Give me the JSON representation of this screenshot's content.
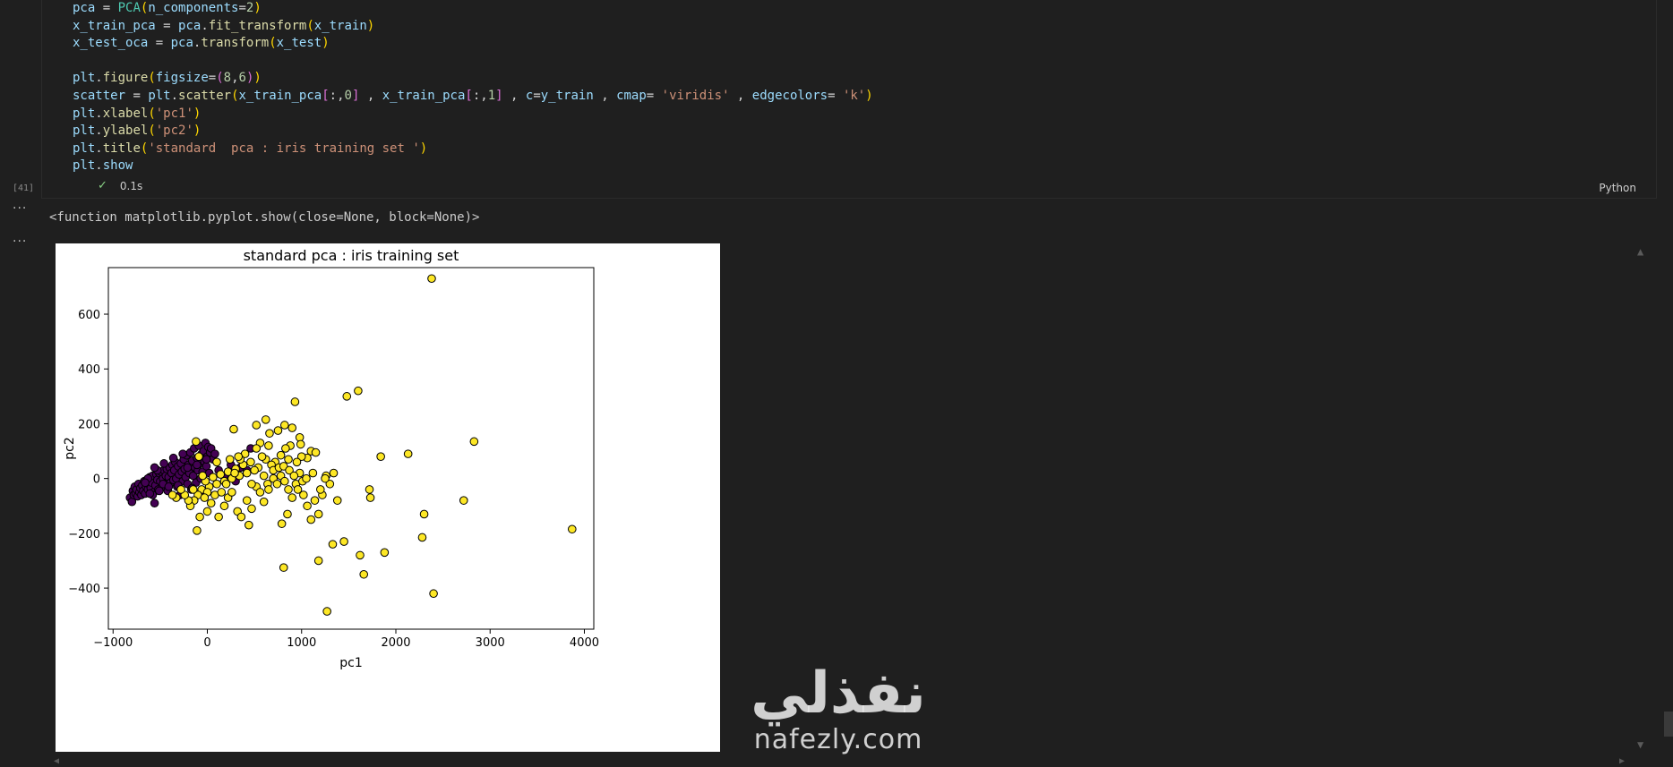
{
  "code_lines": [
    [
      [
        "var",
        "pca"
      ],
      [
        "op",
        " = "
      ],
      [
        "cls",
        "PCA"
      ],
      [
        "par",
        "("
      ],
      [
        "var",
        "n_components"
      ],
      [
        "op",
        "="
      ],
      [
        "num",
        "2"
      ],
      [
        "par",
        ")"
      ]
    ],
    [
      [
        "var",
        "x_train_pca"
      ],
      [
        "op",
        " = "
      ],
      [
        "var",
        "pca"
      ],
      [
        "op",
        "."
      ],
      [
        "fn",
        "fit_transform"
      ],
      [
        "par",
        "("
      ],
      [
        "var",
        "x_train"
      ],
      [
        "par",
        ")"
      ]
    ],
    [
      [
        "var",
        "x_test_oca"
      ],
      [
        "op",
        " = "
      ],
      [
        "var",
        "pca"
      ],
      [
        "op",
        "."
      ],
      [
        "fn",
        "transform"
      ],
      [
        "par",
        "("
      ],
      [
        "var",
        "x_test"
      ],
      [
        "par",
        ")"
      ]
    ],
    [],
    [
      [
        "var",
        "plt"
      ],
      [
        "op",
        "."
      ],
      [
        "fn",
        "figure"
      ],
      [
        "par",
        "("
      ],
      [
        "var",
        "figsize"
      ],
      [
        "op",
        "="
      ],
      [
        "par2",
        "("
      ],
      [
        "num",
        "8"
      ],
      [
        "op",
        ","
      ],
      [
        "num",
        "6"
      ],
      [
        "par2",
        ")"
      ],
      [
        "par",
        ")"
      ]
    ],
    [
      [
        "var",
        "scatter"
      ],
      [
        "op",
        " = "
      ],
      [
        "var",
        "plt"
      ],
      [
        "op",
        "."
      ],
      [
        "fn",
        "scatter"
      ],
      [
        "par",
        "("
      ],
      [
        "var",
        "x_train_pca"
      ],
      [
        "par2",
        "["
      ],
      [
        "op",
        ":,"
      ],
      [
        "num",
        "0"
      ],
      [
        "par2",
        "]"
      ],
      [
        "op",
        " , "
      ],
      [
        "var",
        "x_train_pca"
      ],
      [
        "par2",
        "["
      ],
      [
        "op",
        ":,"
      ],
      [
        "num",
        "1"
      ],
      [
        "par2",
        "]"
      ],
      [
        "op",
        " , "
      ],
      [
        "var",
        "c"
      ],
      [
        "op",
        "="
      ],
      [
        "var",
        "y_train"
      ],
      [
        "op",
        " , "
      ],
      [
        "var",
        "cmap"
      ],
      [
        "op",
        "= "
      ],
      [
        "str",
        "'viridis'"
      ],
      [
        "op",
        " , "
      ],
      [
        "var",
        "edgecolors"
      ],
      [
        "op",
        "= "
      ],
      [
        "str",
        "'k'"
      ],
      [
        "par",
        ")"
      ]
    ],
    [
      [
        "var",
        "plt"
      ],
      [
        "op",
        "."
      ],
      [
        "fn",
        "xlabel"
      ],
      [
        "par",
        "("
      ],
      [
        "str",
        "'pc1'"
      ],
      [
        "par",
        ")"
      ]
    ],
    [
      [
        "var",
        "plt"
      ],
      [
        "op",
        "."
      ],
      [
        "fn",
        "ylabel"
      ],
      [
        "par",
        "("
      ],
      [
        "str",
        "'pc2'"
      ],
      [
        "par",
        ")"
      ]
    ],
    [
      [
        "var",
        "plt"
      ],
      [
        "op",
        "."
      ],
      [
        "fn",
        "title"
      ],
      [
        "par",
        "("
      ],
      [
        "str",
        "'standard  pca : iris training set '"
      ],
      [
        "par",
        ")"
      ]
    ],
    [
      [
        "var",
        "plt"
      ],
      [
        "op",
        "."
      ],
      [
        "var",
        "show"
      ]
    ]
  ],
  "cell": {
    "exec_count": "[41]",
    "time": "0.1s",
    "language": "Python"
  },
  "output_text": "<function matplotlib.pyplot.show(close=None, block=None)>",
  "watermark": {
    "arabic": "نفذلي",
    "latin": "nafezly.com"
  },
  "colors": {
    "class0": "#440154",
    "class1": "#fde725",
    "edge": "#000000"
  },
  "chart_data": {
    "type": "scatter",
    "title": "standard  pca : iris training set",
    "xlabel": "pc1",
    "ylabel": "pc2",
    "xlim": [
      -1050,
      4100
    ],
    "ylim": [
      -550,
      770
    ],
    "xticks": [
      -1000,
      0,
      1000,
      2000,
      3000,
      4000
    ],
    "xtick_labels": [
      "−1000",
      "0",
      "1000",
      "2000",
      "3000",
      "4000"
    ],
    "yticks": [
      -400,
      -200,
      0,
      200,
      400,
      600
    ],
    "ytick_labels": [
      "−400",
      "−200",
      "0",
      "200",
      "400",
      "600"
    ],
    "series": [
      {
        "color": "#440154",
        "points": [
          [
            -820,
            -70
          ],
          [
            -800,
            -85
          ],
          [
            -790,
            -45
          ],
          [
            -780,
            -60
          ],
          [
            -770,
            -30
          ],
          [
            -760,
            -55
          ],
          [
            -750,
            -40
          ],
          [
            -740,
            -65
          ],
          [
            -730,
            -20
          ],
          [
            -720,
            -50
          ],
          [
            -710,
            -35
          ],
          [
            -700,
            -60
          ],
          [
            -690,
            -25
          ],
          [
            -680,
            -45
          ],
          [
            -670,
            -10
          ],
          [
            -660,
            -55
          ],
          [
            -650,
            -30
          ],
          [
            -640,
            -5
          ],
          [
            -630,
            -40
          ],
          [
            -620,
            -20
          ],
          [
            -610,
            5
          ],
          [
            -600,
            -35
          ],
          [
            -590,
            -15
          ],
          [
            -580,
            10
          ],
          [
            -570,
            -50
          ],
          [
            -560,
            -90
          ],
          [
            -550,
            -25
          ],
          [
            -540,
            15
          ],
          [
            -530,
            -5
          ],
          [
            -520,
            -40
          ],
          [
            -510,
            20
          ],
          [
            -500,
            -10
          ],
          [
            -490,
            25
          ],
          [
            -480,
            -30
          ],
          [
            -470,
            0
          ],
          [
            -460,
            30
          ],
          [
            -450,
            -20
          ],
          [
            -440,
            10
          ],
          [
            -430,
            35
          ],
          [
            -420,
            -45
          ],
          [
            -410,
            5
          ],
          [
            -400,
            40
          ],
          [
            -390,
            -15
          ],
          [
            -380,
            20
          ],
          [
            -370,
            50
          ],
          [
            -360,
            -5
          ],
          [
            -350,
            30
          ],
          [
            -340,
            60
          ],
          [
            -330,
            0
          ],
          [
            -320,
            -30
          ],
          [
            -310,
            45
          ],
          [
            -300,
            15
          ],
          [
            -290,
            -60
          ],
          [
            -280,
            55
          ],
          [
            -270,
            25
          ],
          [
            -260,
            -10
          ],
          [
            -250,
            70
          ],
          [
            -240,
            35
          ],
          [
            -230,
            5
          ],
          [
            -220,
            85
          ],
          [
            -210,
            -20
          ],
          [
            -200,
            50
          ],
          [
            -190,
            20
          ],
          [
            -180,
            95
          ],
          [
            -170,
            -40
          ],
          [
            -160,
            65
          ],
          [
            -150,
            10
          ],
          [
            -140,
            110
          ],
          [
            -130,
            40
          ],
          [
            -120,
            -15
          ],
          [
            -110,
            75
          ],
          [
            -100,
            30
          ],
          [
            -90,
            120
          ],
          [
            -80,
            55
          ],
          [
            -70,
            0
          ],
          [
            -60,
            90
          ],
          [
            -50,
            25
          ],
          [
            -40,
            100
          ],
          [
            -30,
            60
          ],
          [
            -20,
            130
          ],
          [
            -10,
            45
          ],
          [
            0,
            80
          ],
          [
            10,
            115
          ],
          [
            20,
            20
          ],
          [
            30,
            95
          ],
          [
            40,
            110
          ],
          [
            60,
            70
          ],
          [
            80,
            90
          ],
          [
            120,
            30
          ],
          [
            180,
            10
          ],
          [
            250,
            50
          ],
          [
            300,
            -10
          ],
          [
            350,
            40
          ],
          [
            420,
            30
          ],
          [
            460,
            110
          ],
          [
            -470,
            -20
          ],
          [
            -530,
            30
          ],
          [
            -580,
            -60
          ],
          [
            -630,
            0
          ],
          [
            -660,
            -15
          ],
          [
            -610,
            -55
          ],
          [
            -560,
            40
          ],
          [
            -510,
            -45
          ],
          [
            -460,
            55
          ],
          [
            -410,
            -30
          ],
          [
            -360,
            75
          ],
          [
            -310,
            -25
          ],
          [
            -260,
            90
          ],
          [
            -210,
            40
          ],
          [
            -160,
            -35
          ],
          [
            -110,
            50
          ],
          [
            -60,
            -45
          ],
          [
            -10,
            70
          ]
        ]
      },
      {
        "color": "#fde725",
        "points": [
          [
            2380,
            730
          ],
          [
            1600,
            320
          ],
          [
            1480,
            300
          ],
          [
            930,
            280
          ],
          [
            280,
            180
          ],
          [
            520,
            195
          ],
          [
            620,
            215
          ],
          [
            820,
            195
          ],
          [
            900,
            185
          ],
          [
            660,
            165
          ],
          [
            750,
            175
          ],
          [
            980,
            150
          ],
          [
            990,
            125
          ],
          [
            880,
            120
          ],
          [
            830,
            110
          ],
          [
            1100,
            100
          ],
          [
            1060,
            75
          ],
          [
            1150,
            95
          ],
          [
            1000,
            80
          ],
          [
            950,
            60
          ],
          [
            860,
            70
          ],
          [
            780,
            85
          ],
          [
            720,
            60
          ],
          [
            680,
            50
          ],
          [
            620,
            70
          ],
          [
            580,
            80
          ],
          [
            540,
            40
          ],
          [
            500,
            30
          ],
          [
            460,
            60
          ],
          [
            420,
            20
          ],
          [
            380,
            50
          ],
          [
            340,
            10
          ],
          [
            300,
            35
          ],
          [
            260,
            0
          ],
          [
            220,
            25
          ],
          [
            180,
            -10
          ],
          [
            140,
            15
          ],
          [
            100,
            -20
          ],
          [
            60,
            5
          ],
          [
            20,
            -30
          ],
          [
            -20,
            -10
          ],
          [
            -60,
            -40
          ],
          [
            -100,
            -60
          ],
          [
            -140,
            -80
          ],
          [
            -180,
            -100
          ],
          [
            -110,
            -190
          ],
          [
            -80,
            -140
          ],
          [
            0,
            -120
          ],
          [
            40,
            -90
          ],
          [
            80,
            -60
          ],
          [
            120,
            -140
          ],
          [
            180,
            -100
          ],
          [
            220,
            -70
          ],
          [
            260,
            -50
          ],
          [
            320,
            -120
          ],
          [
            360,
            -140
          ],
          [
            420,
            -80
          ],
          [
            440,
            -170
          ],
          [
            470,
            -110
          ],
          [
            520,
            -30
          ],
          [
            560,
            -50
          ],
          [
            600,
            -85
          ],
          [
            640,
            -20
          ],
          [
            700,
            0
          ],
          [
            740,
            -20
          ],
          [
            780,
            10
          ],
          [
            820,
            -10
          ],
          [
            860,
            -40
          ],
          [
            900,
            -70
          ],
          [
            940,
            -20
          ],
          [
            980,
            20
          ],
          [
            1020,
            -60
          ],
          [
            1060,
            -100
          ],
          [
            1100,
            -150
          ],
          [
            1140,
            -80
          ],
          [
            1180,
            -130
          ],
          [
            1220,
            -60
          ],
          [
            1260,
            10
          ],
          [
            1300,
            -20
          ],
          [
            1340,
            20
          ],
          [
            1380,
            -80
          ],
          [
            1180,
            -300
          ],
          [
            1330,
            -240
          ],
          [
            1450,
            -230
          ],
          [
            1620,
            -280
          ],
          [
            1660,
            -350
          ],
          [
            1880,
            -270
          ],
          [
            1270,
            -485
          ],
          [
            810,
            -325
          ],
          [
            850,
            -130
          ],
          [
            790,
            -165
          ],
          [
            2300,
            -130
          ],
          [
            2280,
            -215
          ],
          [
            2400,
            -420
          ],
          [
            2720,
            -80
          ],
          [
            2830,
            135
          ],
          [
            2130,
            90
          ],
          [
            1840,
            80
          ],
          [
            1720,
            -40
          ],
          [
            1730,
            -70
          ],
          [
            3870,
            -185
          ],
          [
            -120,
            135
          ],
          [
            -90,
            80
          ],
          [
            560,
            130
          ],
          [
            650,
            120
          ],
          [
            400,
            90
          ],
          [
            350,
            70
          ],
          [
            700,
            30
          ],
          [
            760,
            40
          ],
          [
            810,
            45
          ],
          [
            870,
            30
          ],
          [
            920,
            10
          ],
          [
            960,
            -40
          ],
          [
            1010,
            -10
          ],
          [
            1050,
            0
          ],
          [
            1120,
            20
          ],
          [
            1200,
            -40
          ],
          [
            1250,
            0
          ],
          [
            100,
            60
          ],
          [
            150,
            -50
          ],
          [
            200,
            -20
          ],
          [
            240,
            70
          ],
          [
            290,
            20
          ],
          [
            330,
            80
          ],
          [
            470,
            -20
          ],
          [
            520,
            110
          ],
          [
            600,
            10
          ],
          [
            650,
            -40
          ],
          [
            0,
            -50
          ],
          [
            -30,
            -70
          ],
          [
            -50,
            10
          ],
          [
            -150,
            -40
          ],
          [
            -200,
            -80
          ],
          [
            -240,
            -60
          ],
          [
            -280,
            -40
          ],
          [
            -330,
            -70
          ],
          [
            -370,
            -60
          ]
        ]
      }
    ]
  }
}
